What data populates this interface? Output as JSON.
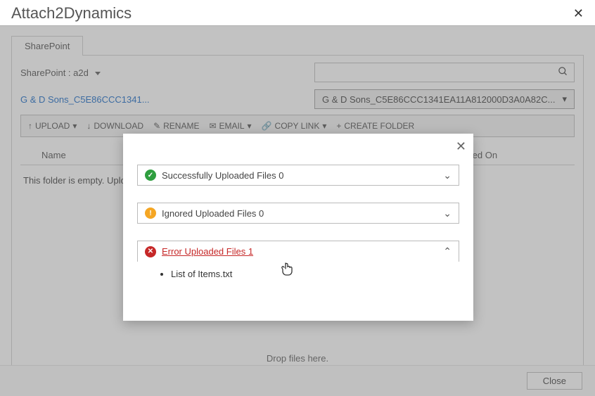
{
  "header": {
    "title": "Attach2Dynamics",
    "close_glyph": "✕"
  },
  "tab_label": "SharePoint",
  "sp_context_label": "SharePoint : a2d",
  "breadcrumb": "G & D Sons_C5E86CCC1341...",
  "dropdown_selected": "G & D Sons_C5E86CCC1341EA11A812000D3A0A82C...",
  "toolbar": {
    "upload": "UPLOAD",
    "download": "DOWNLOAD",
    "rename": "RENAME",
    "email": "EMAIL",
    "copylink": "COPY LINK",
    "createfolder": "CREATE FOLDER"
  },
  "columns": {
    "name": "Name",
    "modified": "Modified On"
  },
  "empty_message": "This folder is empty. Uplo",
  "drop_hint": "Drop files here.",
  "modal": {
    "close_glyph": "✕",
    "success_label": "Successfully Uploaded Files 0",
    "ignored_label": "Ignored Uploaded Files 0",
    "error_label": "Error Uploaded Files 1",
    "error_items": [
      "List of Items.txt"
    ]
  },
  "footer": {
    "close_label": "Close"
  },
  "glyphs": {
    "check": "✓",
    "bang": "!",
    "x": "✕",
    "chev_down": "⌄",
    "chev_up": "⌃",
    "up": "↑",
    "down": "↓",
    "pencil": "✎",
    "mail": "✉",
    "link": "🔗",
    "plus": "+"
  }
}
